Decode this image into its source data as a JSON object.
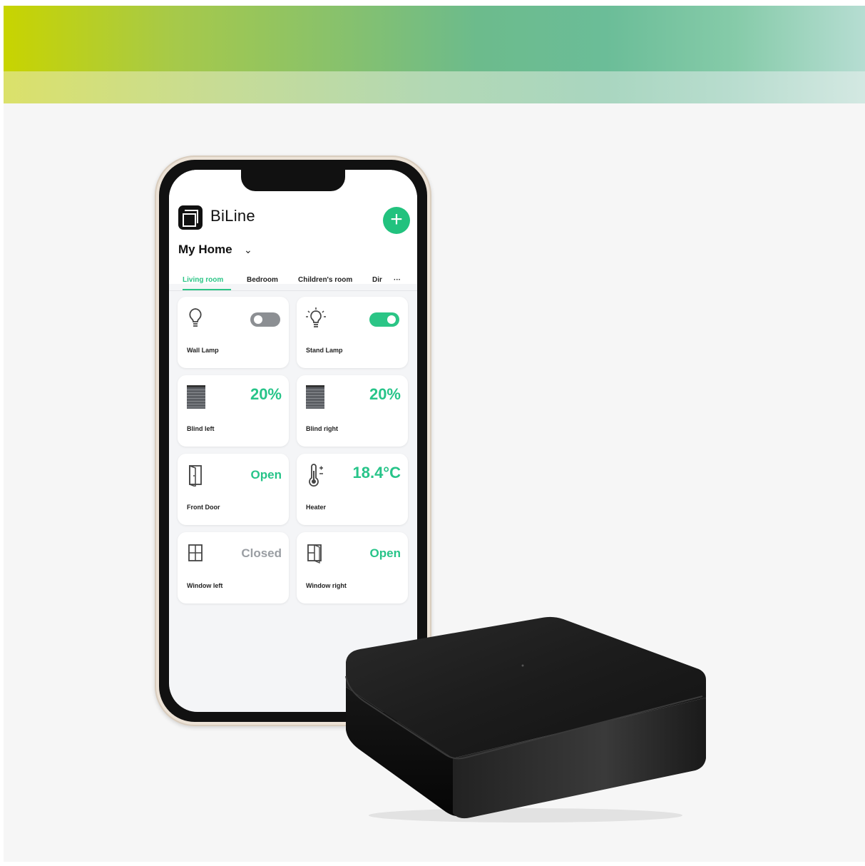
{
  "app": {
    "brand": "BiLine",
    "home_selector": "My Home",
    "add_button_icon": "plus-icon",
    "accent_color": "#22c27e"
  },
  "tabs": [
    {
      "label": "Living room",
      "active": true
    },
    {
      "label": "Bedroom",
      "active": false
    },
    {
      "label": "Children's room",
      "active": false
    },
    {
      "label": "Dir",
      "active": false
    },
    {
      "label": "···",
      "active": false
    }
  ],
  "devices": [
    {
      "name": "Wall Lamp",
      "icon": "bulb-icon",
      "control": "toggle",
      "on": false
    },
    {
      "name": "Stand Lamp",
      "icon": "bulb-lit-icon",
      "control": "toggle",
      "on": true
    },
    {
      "name": "Blind left",
      "icon": "blind-icon",
      "value": "20%"
    },
    {
      "name": "Blind right",
      "icon": "blind-icon",
      "value": "20%"
    },
    {
      "name": "Front Door",
      "icon": "door-icon",
      "value": "Open"
    },
    {
      "name": "Heater",
      "icon": "thermometer-icon",
      "value": "18.4°C"
    },
    {
      "name": "Window left",
      "icon": "window-icon",
      "value": "Closed"
    },
    {
      "name": "Window right",
      "icon": "window-open-icon",
      "value": "Open"
    }
  ]
}
